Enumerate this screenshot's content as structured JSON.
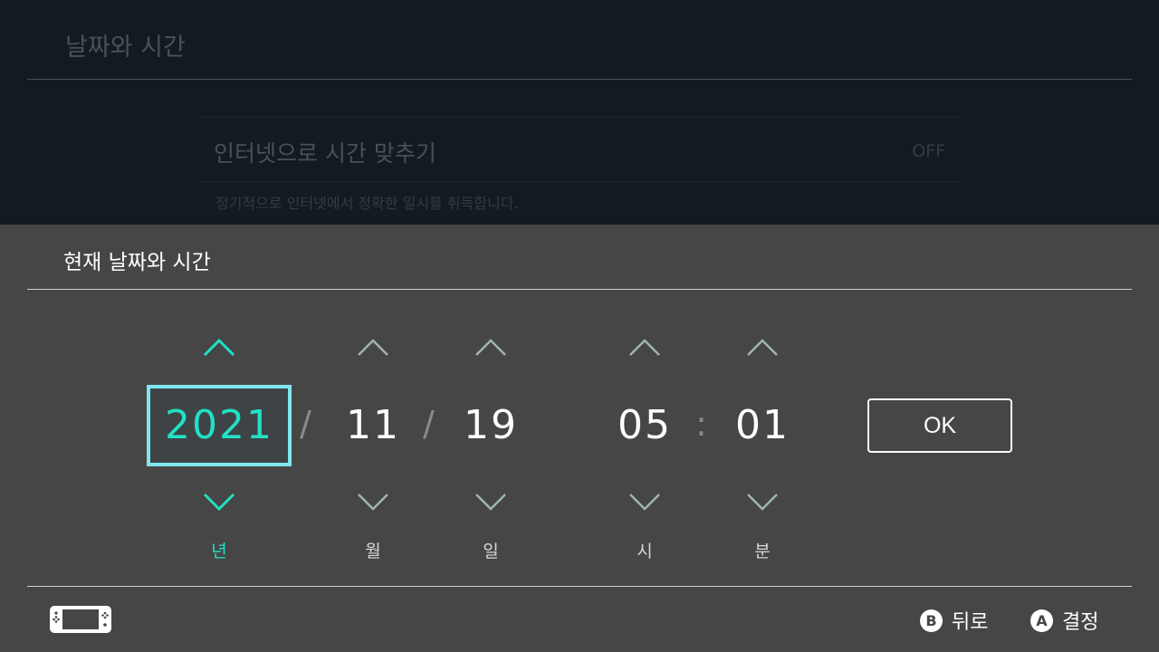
{
  "background": {
    "title": "날짜와 시간",
    "row_label": "인터넷으로 시간 맞추기",
    "row_value": "OFF",
    "row_description": "정기적으로 인터넷에서 정확한 일시를 취득합니다."
  },
  "dialog": {
    "title": "현재 날짜와 시간",
    "fields": [
      {
        "value": "2021",
        "unit": "년"
      },
      {
        "value": "11",
        "unit": "월"
      },
      {
        "value": "19",
        "unit": "일"
      },
      {
        "value": "05",
        "unit": "시"
      },
      {
        "value": "01",
        "unit": "분"
      }
    ],
    "separators": {
      "date": "/",
      "time": ":"
    },
    "ok_label": "OK"
  },
  "footer": {
    "back_glyph": "B",
    "back_label": "뒤로",
    "confirm_glyph": "A",
    "confirm_label": "결정"
  },
  "colors": {
    "accent": "#22e0c4",
    "selection_border": "#7fe6f0",
    "panel_bg": "#464646",
    "page_bg": "#131a22"
  },
  "icons": [
    "chevron-up-icon",
    "chevron-down-icon",
    "handheld-console-icon"
  ]
}
